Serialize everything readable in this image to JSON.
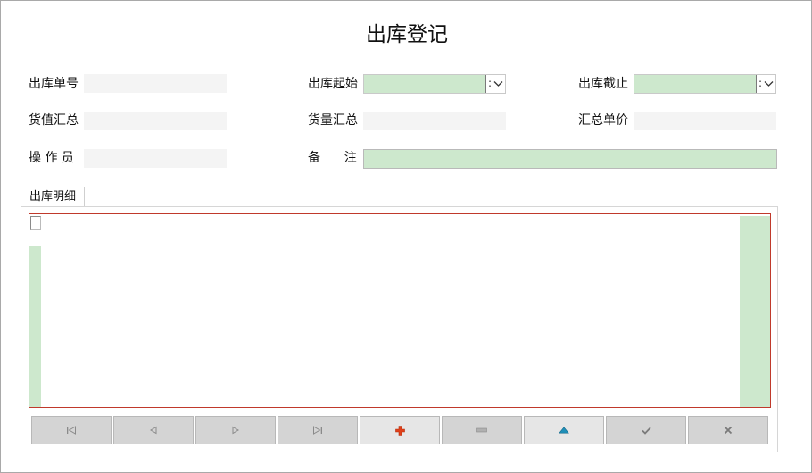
{
  "form": {
    "title": "出库登记"
  },
  "fields": {
    "order_no": {
      "label": "出库单号",
      "value": ""
    },
    "start": {
      "label": "出库起始",
      "value": "",
      "dd_glyph": ":"
    },
    "end": {
      "label": "出库截止",
      "value": "",
      "dd_glyph": ":"
    },
    "goods_value": {
      "label": "货值汇总",
      "value": ""
    },
    "qty_total": {
      "label": "货量汇总",
      "value": ""
    },
    "unit_price": {
      "label": "汇总单价",
      "value": ""
    },
    "operator": {
      "label": "操 作 员",
      "value": ""
    },
    "remark": {
      "label": "备      注",
      "value": ""
    }
  },
  "tabs": {
    "detail_label": "出库明细"
  },
  "navigator": {
    "buttons": [
      {
        "name": "first-record",
        "icon": "first-icon"
      },
      {
        "name": "prior-record",
        "icon": "prior-icon"
      },
      {
        "name": "next-record",
        "icon": "next-icon"
      },
      {
        "name": "last-record",
        "icon": "last-icon"
      },
      {
        "name": "insert-record",
        "icon": "plus-icon"
      },
      {
        "name": "delete-record",
        "icon": "minus-icon"
      },
      {
        "name": "edit-record",
        "icon": "up-triangle-icon"
      },
      {
        "name": "post-record",
        "icon": "check-icon"
      },
      {
        "name": "cancel-record",
        "icon": "cross-icon"
      }
    ]
  },
  "colors": {
    "input_green": "#cde8cd",
    "grid_border": "#c0392b",
    "plus_red": "#e0401a",
    "edit_blue": "#1f8fb8"
  }
}
